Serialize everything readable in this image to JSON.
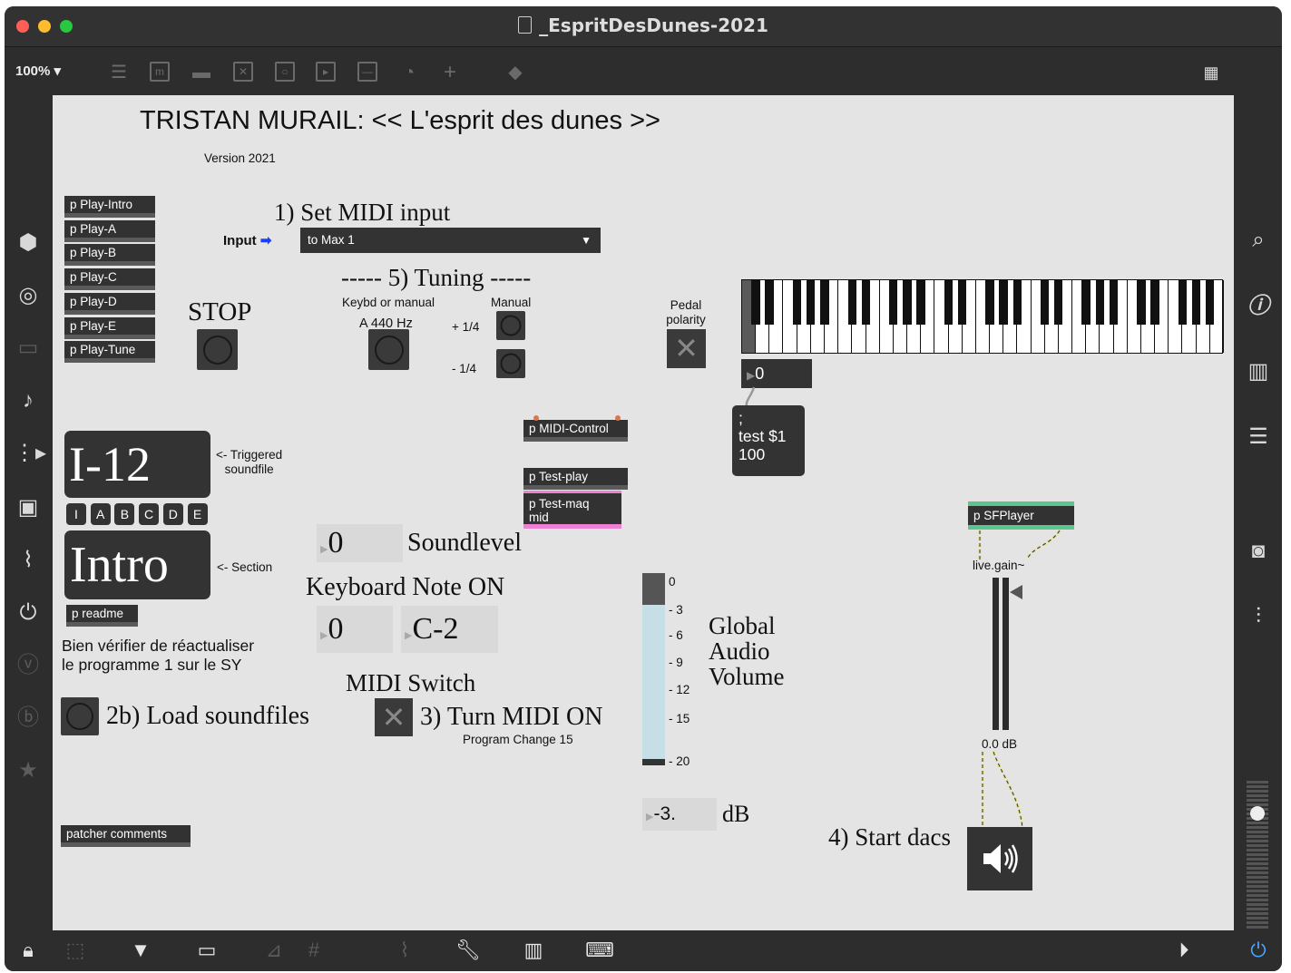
{
  "window": {
    "title": "_EspritDesDunes-2021"
  },
  "toolbar": {
    "zoom": "100%",
    "icons": [
      "layout-icon",
      "message-icon",
      "comment-icon",
      "toggle-icon",
      "button-icon",
      "play-icon",
      "slider-icon",
      "dial-icon",
      "add-icon",
      "paint-icon"
    ],
    "grid_icon": "grid-icon"
  },
  "canvas": {
    "title": "TRISTAN MURAIL:  << L'esprit des dunes >>",
    "version": "Version 2021",
    "play_subpatchers": [
      "p Play-Intro",
      "p Play-A",
      "p Play-B",
      "p Play-C",
      "p Play-D",
      "p Play-E",
      "p Play-Tune"
    ],
    "set_midi_input": "1) Set MIDI input",
    "input_label": "Input",
    "midi_input_menu": "to Max 1",
    "tuning_header": "----- 5) Tuning -----",
    "stop_label": "STOP",
    "kbd_or_manual": "Keybd or manual",
    "a440": "A 440 Hz",
    "manual_label": "Manual",
    "plus_quarter": "+ 1/4",
    "minus_quarter": "- 1/4",
    "pedal_label": "Pedal\npolarity",
    "kbd_num": "0",
    "test_msg": ";\ntest $1\n100",
    "midi_control": "p MIDI-Control",
    "test_play": "p Test-play",
    "test_maq": "p Test-maq\nmid",
    "section_display": "I-12",
    "triggered_label": "<- Triggered\nsoundfile",
    "section_buttons": [
      "I",
      "A",
      "B",
      "C",
      "D",
      "E"
    ],
    "intro_display": "Intro",
    "section_label": "<- Section",
    "readme": "p readme",
    "warning": "Bien vérifier de réactualiser\nle programme 1 sur le SY",
    "load_soundfiles": "2b) Load soundfiles",
    "soundlevel_value": "0",
    "soundlevel_label": "Soundlevel",
    "keyboard_note_on": "Keyboard Note ON",
    "note_value": "0",
    "note_name": "C-2",
    "midi_switch": "MIDI Switch",
    "turn_midi_on": "3) Turn MIDI ON",
    "program_change": "Program Change 15",
    "patcher_comments": "patcher comments",
    "global_volume": "Global\nAudio\nVolume",
    "meter_ticks": [
      "0",
      "- 3",
      "- 6",
      "- 9",
      "- 12",
      "- 15",
      "- 20"
    ],
    "db_value": "-3.",
    "db_label": "dB",
    "sfplayer": "p SFPlayer",
    "livegain": "live.gain~",
    "gain_value": "0.0 dB",
    "start_dacs": "4) Start dacs"
  },
  "levels": {
    "global_volume_fraction": 0.83,
    "live_gain_fraction": 1.0
  }
}
